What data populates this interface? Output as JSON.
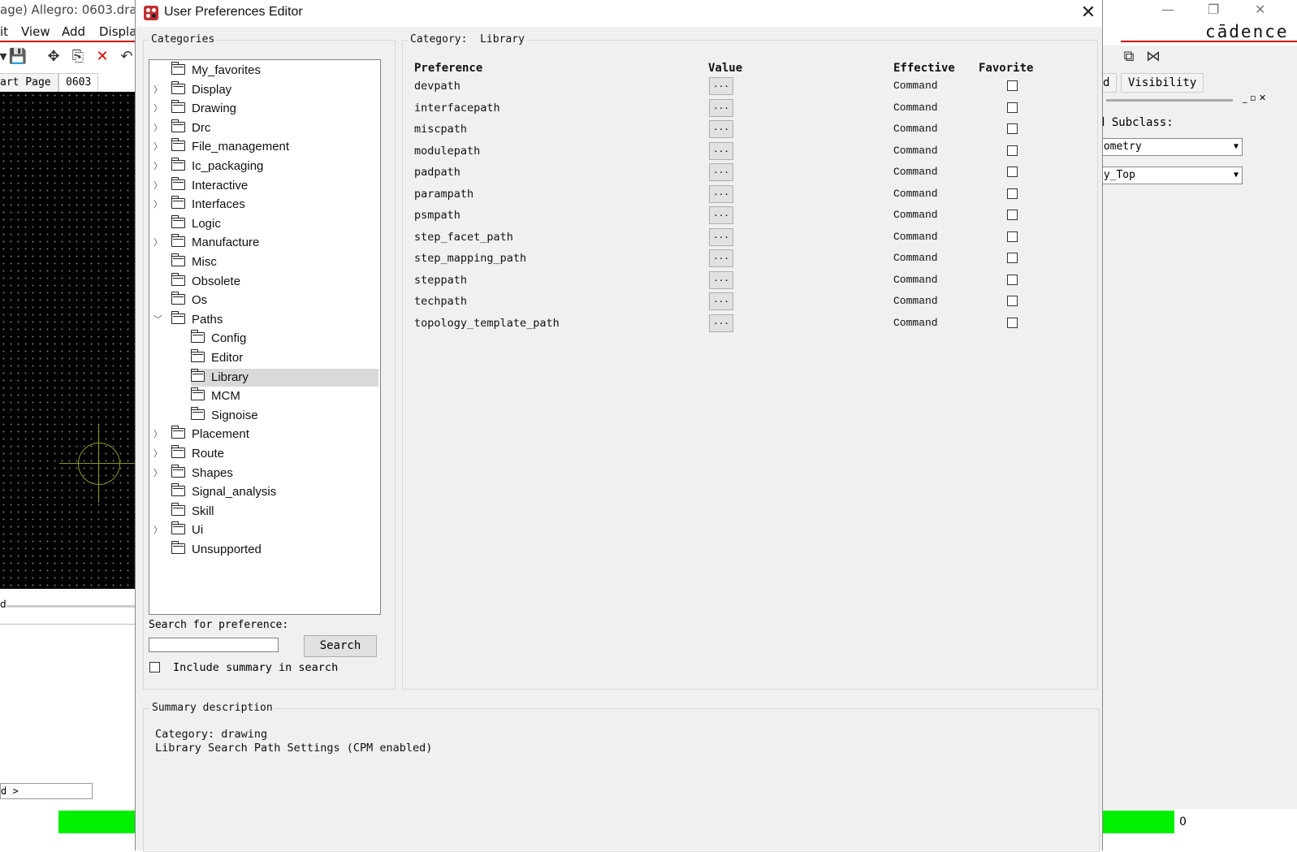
{
  "background_app": {
    "window_title": "age) Allegro: 0603.dra",
    "menu": [
      "it",
      "View",
      "Add",
      "Displa"
    ],
    "tabs": [
      "art Page",
      "0603"
    ],
    "brand": "cādence",
    "right_panel": {
      "tabs": [
        "d",
        "Visibility"
      ],
      "subclass_label": "d Subclass:",
      "class_select": "eometry",
      "subclass_select": "ly_Top"
    },
    "cmd_prompt": "d >",
    "status_value": "0",
    "left_label": "d"
  },
  "dialog": {
    "title": "User Preferences Editor",
    "categories_label": "Categories",
    "category_prefix": "Category:",
    "current_category": "Library",
    "tree": [
      {
        "label": "My_favorites",
        "expandable": false,
        "level": 0
      },
      {
        "label": "Display",
        "expandable": true,
        "level": 0
      },
      {
        "label": "Drawing",
        "expandable": true,
        "level": 0
      },
      {
        "label": "Drc",
        "expandable": true,
        "level": 0
      },
      {
        "label": "File_management",
        "expandable": true,
        "level": 0
      },
      {
        "label": "Ic_packaging",
        "expandable": true,
        "level": 0
      },
      {
        "label": "Interactive",
        "expandable": true,
        "level": 0
      },
      {
        "label": "Interfaces",
        "expandable": true,
        "level": 0
      },
      {
        "label": "Logic",
        "expandable": false,
        "level": 0
      },
      {
        "label": "Manufacture",
        "expandable": true,
        "level": 0
      },
      {
        "label": "Misc",
        "expandable": false,
        "level": 0
      },
      {
        "label": "Obsolete",
        "expandable": false,
        "level": 0
      },
      {
        "label": "Os",
        "expandable": false,
        "level": 0
      },
      {
        "label": "Paths",
        "expandable": true,
        "expanded": true,
        "level": 0
      },
      {
        "label": "Config",
        "expandable": false,
        "level": 1
      },
      {
        "label": "Editor",
        "expandable": false,
        "level": 1
      },
      {
        "label": "Library",
        "expandable": false,
        "level": 1,
        "selected": true
      },
      {
        "label": "MCM",
        "expandable": false,
        "level": 1
      },
      {
        "label": "Signoise",
        "expandable": false,
        "level": 1
      },
      {
        "label": "Placement",
        "expandable": true,
        "level": 0
      },
      {
        "label": "Route",
        "expandable": true,
        "level": 0
      },
      {
        "label": "Shapes",
        "expandable": true,
        "level": 0
      },
      {
        "label": "Signal_analysis",
        "expandable": false,
        "level": 0
      },
      {
        "label": "Skill",
        "expandable": false,
        "level": 0
      },
      {
        "label": "Ui",
        "expandable": true,
        "level": 0
      },
      {
        "label": "Unsupported",
        "expandable": false,
        "level": 0
      }
    ],
    "search": {
      "label": "Search for preference:",
      "value": "",
      "button": "Search",
      "include_summary_label": "Include summary in search",
      "include_summary_checked": false
    },
    "columns": {
      "preference": "Preference",
      "value": "Value",
      "effective": "Effective",
      "favorite": "Favorite"
    },
    "preferences": [
      {
        "name": "devpath",
        "value_button": "...",
        "effective": "Command",
        "favorite": false
      },
      {
        "name": "interfacepath",
        "value_button": "...",
        "effective": "Command",
        "favorite": false
      },
      {
        "name": "miscpath",
        "value_button": "...",
        "effective": "Command",
        "favorite": false
      },
      {
        "name": "modulepath",
        "value_button": "...",
        "effective": "Command",
        "favorite": false
      },
      {
        "name": "padpath",
        "value_button": "...",
        "effective": "Command",
        "favorite": false
      },
      {
        "name": "parampath",
        "value_button": "...",
        "effective": "Command",
        "favorite": false
      },
      {
        "name": "psmpath",
        "value_button": "...",
        "effective": "Command",
        "favorite": false
      },
      {
        "name": "step_facet_path",
        "value_button": "...",
        "effective": "Command",
        "favorite": false
      },
      {
        "name": "step_mapping_path",
        "value_button": "...",
        "effective": "Command",
        "favorite": false
      },
      {
        "name": "steppath",
        "value_button": "...",
        "effective": "Command",
        "favorite": false
      },
      {
        "name": "techpath",
        "value_button": "...",
        "effective": "Command",
        "favorite": false
      },
      {
        "name": "topology_template_path",
        "value_button": "...",
        "effective": "Command",
        "favorite": false
      }
    ],
    "summary": {
      "label": "Summary description",
      "line1": "Category: drawing",
      "line2": "Library Search Path Settings (CPM enabled)"
    }
  },
  "colors": {
    "status_green": "#00f000",
    "accent_red": "#cc0000",
    "selection": "#d9d9d9"
  },
  "icons": [
    "app-logo-icon",
    "close-icon",
    "folder-icon",
    "chevron-right-icon",
    "chevron-down-icon"
  ]
}
